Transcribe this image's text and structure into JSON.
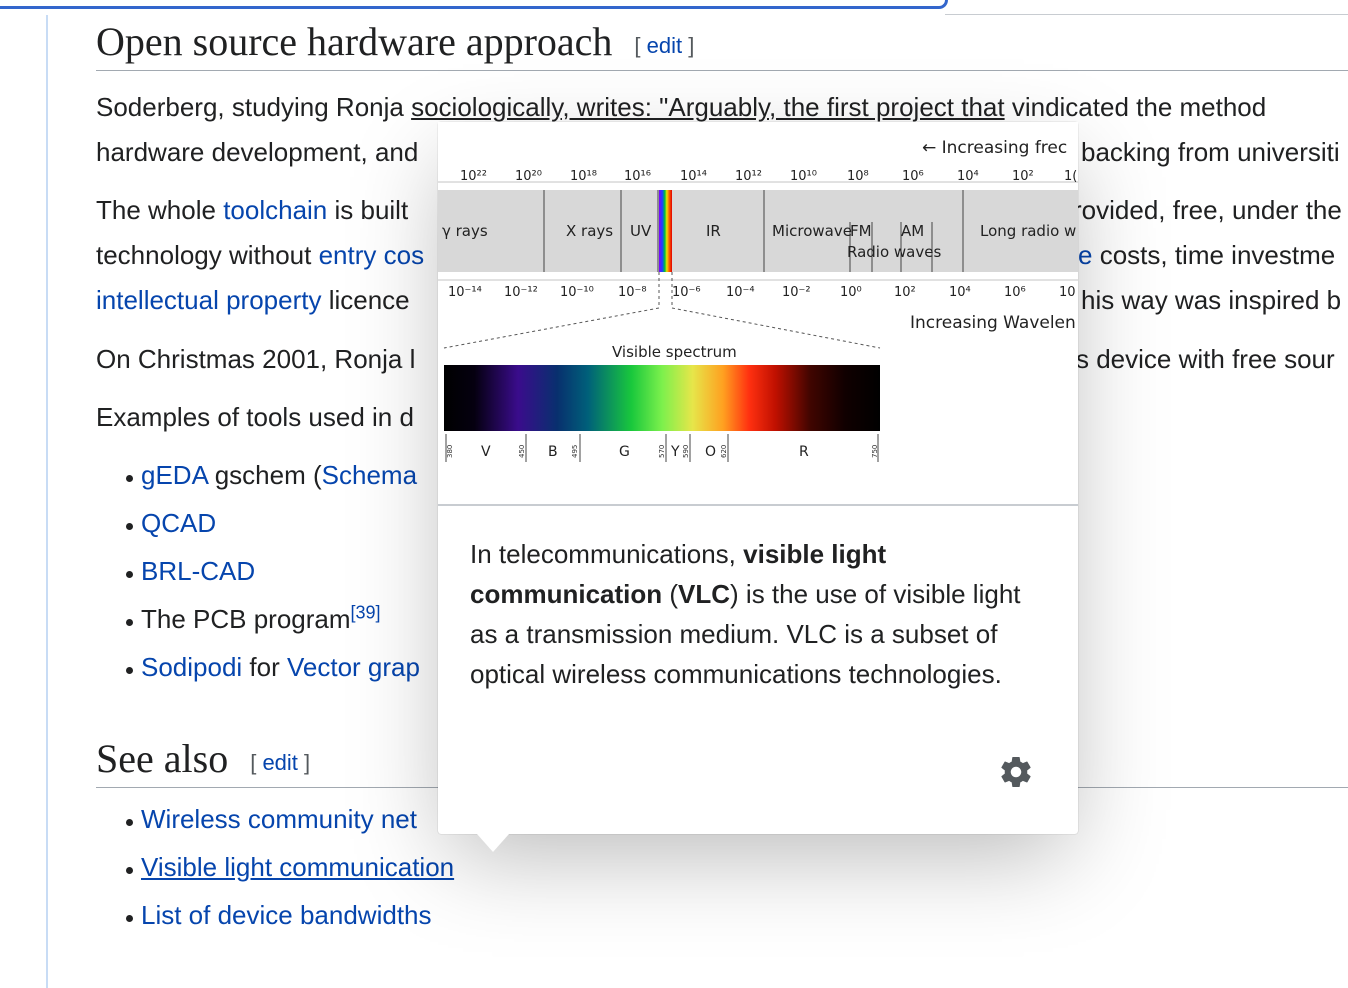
{
  "section1": {
    "title": "Open source hardware approach",
    "edit_left": "[",
    "edit": "edit",
    "edit_right": "]"
  },
  "paragraphs": {
    "p1_a": "Soderberg, studying Ronja ",
    "p1_link": "sociologically, writes: \"Arguably, the first project that",
    "p1_b": " vindicated the method",
    "p2_a": "hardware development, and",
    "p2_b": "backing from universiti",
    "p3_a": "The whole ",
    "p3_link": "toolchain",
    "p3_b": " is built",
    "p3_c": "rovided, free, under the",
    "p4_a": "technology without ",
    "p4_link": "entry cos",
    "p4_link2": "e",
    "p4_c": " costs, time investme",
    "p5_link": "intellectual property",
    "p5_b": " licence",
    "p5_c": "his way was inspired b",
    "p6_a": "On Christmas 2001, Ronja l",
    "p6_c": "s device with free sour",
    "p7_a": "Examples of tools used in d"
  },
  "tools": [
    {
      "link": "gEDA",
      "text": " gschem (",
      "link2": "Schema"
    },
    {
      "link": "QCAD"
    },
    {
      "link": "BRL-CAD"
    },
    {
      "text": "The PCB program",
      "ref": "[39]"
    },
    {
      "link": "Sodipodi",
      "text": " for ",
      "link2": "Vector grap"
    }
  ],
  "section2": {
    "title": "See also",
    "edit_left": "[",
    "edit": "edit",
    "edit_right": "]"
  },
  "see_also": [
    {
      "link": "Wireless community net"
    },
    {
      "link": "Visible light communication"
    },
    {
      "link": "List of device bandwidths"
    }
  ],
  "popup": {
    "diagram": {
      "freq_label": "← Increasing frec",
      "wavelength_label": "Increasing Wavelen",
      "freq_ticks": [
        "10²²",
        "10²⁰",
        "10¹⁸",
        "10¹⁶",
        "10¹⁴",
        "10¹²",
        "10¹⁰",
        "10⁸",
        "10⁶",
        "10⁴",
        "10²",
        "1("
      ],
      "wave_ticks": [
        "10⁻¹⁴",
        "10⁻¹²",
        "10⁻¹⁰",
        "10⁻⁸",
        "10⁻⁶",
        "10⁻⁴",
        "10⁻²",
        "10⁰",
        "10²",
        "10⁴",
        "10⁶",
        "10"
      ],
      "bands": [
        "γ rays",
        "X rays",
        "UV",
        "IR",
        "Microwave",
        "FM",
        "AM",
        "Radio waves",
        "Long radio w"
      ],
      "visible_title": "Visible spectrum",
      "colors": [
        "V",
        "B",
        "G",
        "Y",
        "O",
        "R"
      ],
      "nm": [
        "380",
        "450",
        "495",
        "570",
        "590",
        "620",
        "750"
      ]
    },
    "extract_a": "In telecommunications, ",
    "extract_b1": "visible light communication",
    "extract_c": " (",
    "extract_b2": "VLC",
    "extract_d": ") is the use of visible light as a transmission medium. VLC is a subset of optical wireless communications technologies."
  }
}
